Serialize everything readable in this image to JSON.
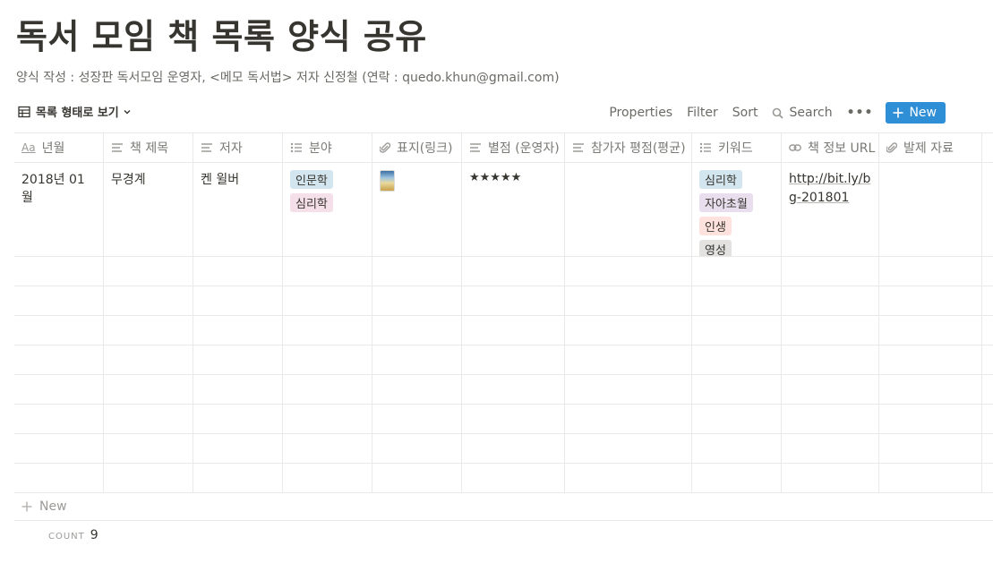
{
  "page": {
    "title": "독서 모임 책 목록 양식 공유",
    "subtitle": "양식 작성 : 성장판 독서모임 운영자, <메모 독서법> 저자 신정철 (연락 : quedo.khun@gmail.com)"
  },
  "toolbar": {
    "view_label": "목록 형태로 보기",
    "properties": "Properties",
    "filter": "Filter",
    "sort": "Sort",
    "search": "Search",
    "more": "•••",
    "new": "New"
  },
  "columns": [
    {
      "label": "년월",
      "icon": "title-icon"
    },
    {
      "label": "책 제목",
      "icon": "text-icon"
    },
    {
      "label": "저자",
      "icon": "text-icon"
    },
    {
      "label": "분야",
      "icon": "multi-select-icon"
    },
    {
      "label": "표지(링크)",
      "icon": "attachment-icon"
    },
    {
      "label": "별점 (운영자)",
      "icon": "text-icon"
    },
    {
      "label": "참가자 평점(평균)",
      "icon": "text-icon"
    },
    {
      "label": "키워드",
      "icon": "multi-select-icon"
    },
    {
      "label": "책 정보 URL",
      "icon": "url-icon"
    },
    {
      "label": "발제 자료",
      "icon": "attachment-icon"
    }
  ],
  "rows": [
    {
      "date": "2018년 01월",
      "book_title": "무경계",
      "author": "켄 윌버",
      "field": [
        {
          "label": "인문학",
          "color": "#d3e5ef"
        },
        {
          "label": "심리학",
          "color": "#f5e0e9"
        }
      ],
      "rating": "★★★★★",
      "keywords": [
        {
          "label": "심리학",
          "color": "#d3e5ef"
        },
        {
          "label": "자아초월",
          "color": "#e8deee"
        },
        {
          "label": "인생",
          "color": "#ffe2dd"
        },
        {
          "label": "영성",
          "color": "#e3e2e0"
        }
      ],
      "url": "http://bit.ly/bg-201801"
    }
  ],
  "footer": {
    "add_new": "New",
    "count_label": "COUNT",
    "count_value": "9"
  }
}
